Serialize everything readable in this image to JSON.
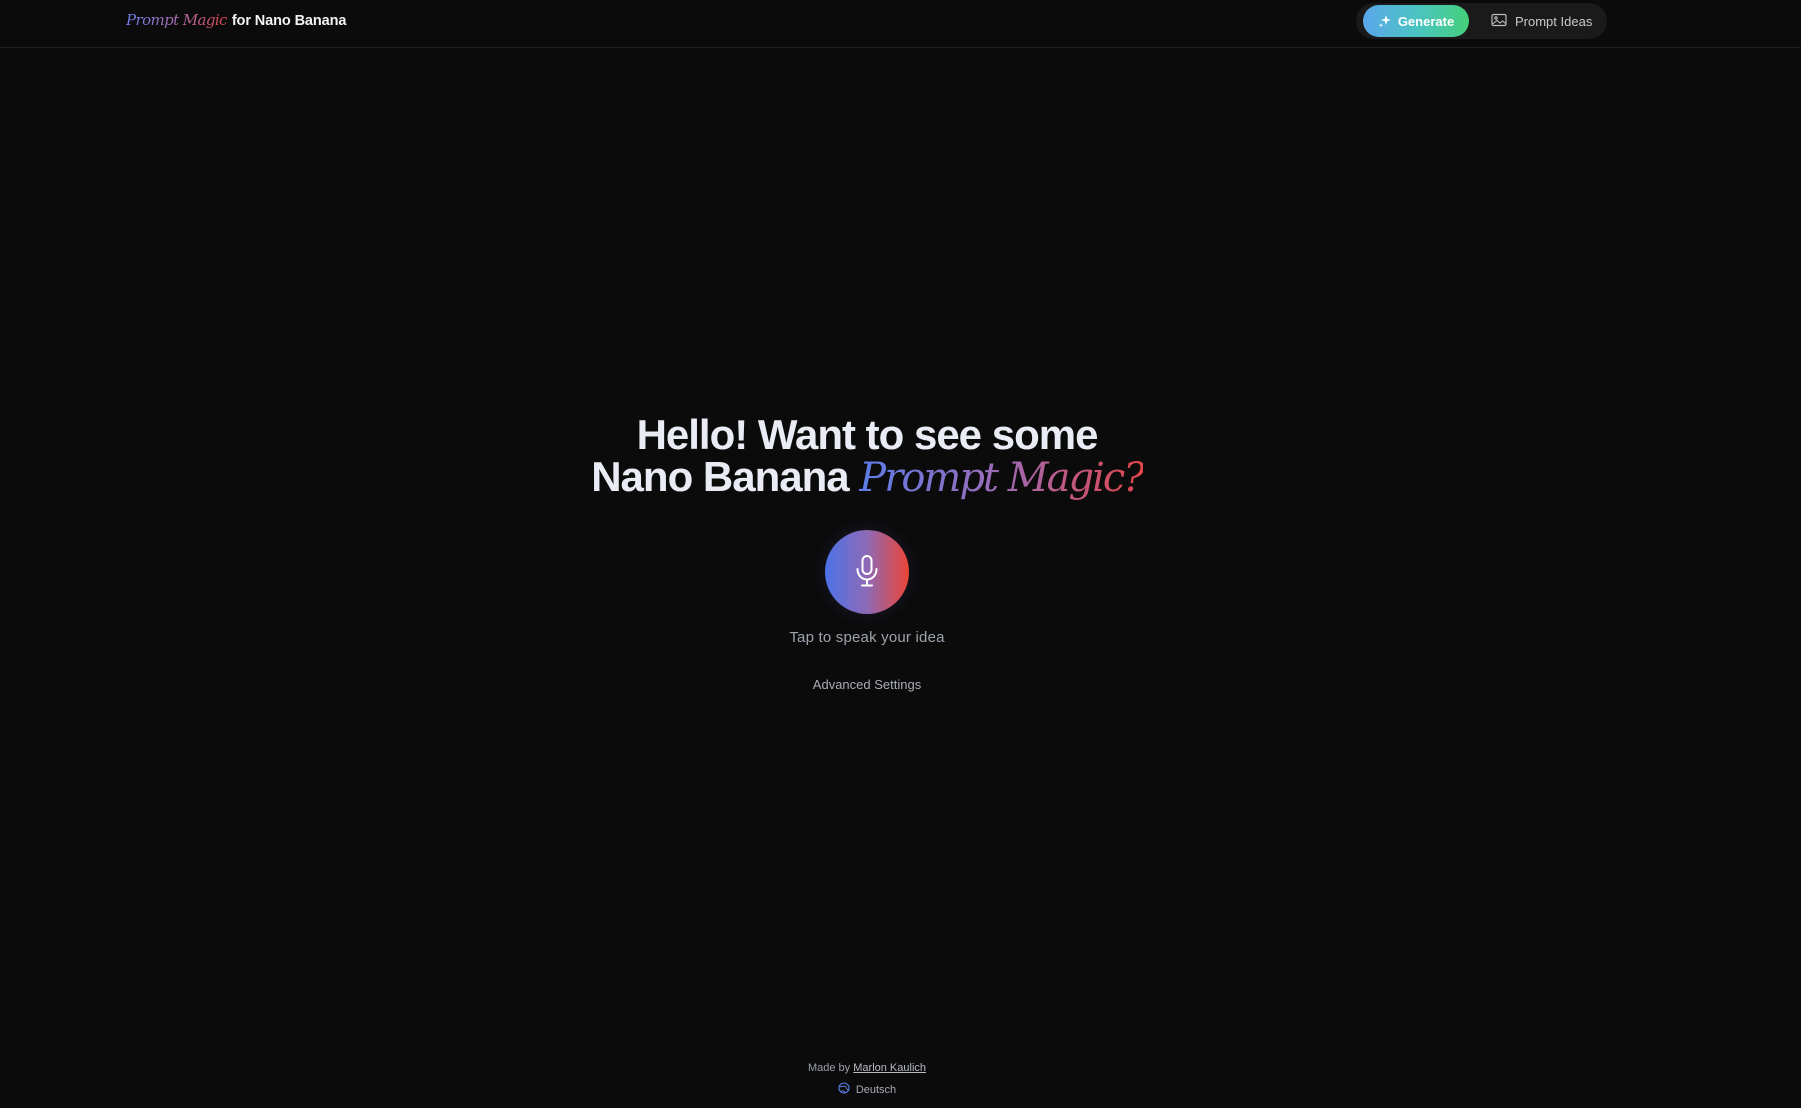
{
  "header": {
    "brand_magic": "Prompt Magic",
    "brand_rest": "for Nano Banana",
    "nav": {
      "generate_label": "Generate",
      "generate_icon": "sparkles-icon",
      "ideas_label": "Prompt Ideas",
      "ideas_icon": "image-icon"
    }
  },
  "hero": {
    "headline_line1": "Hello! Want to see some",
    "headline_line2_plain": "Nano Banana",
    "headline_line2_magic": "Prompt Magic?",
    "mic_icon": "microphone-icon",
    "tap_hint": "Tap to speak your idea",
    "advanced_settings": "Advanced Settings"
  },
  "footer": {
    "made_by_prefix": "Made by",
    "author": "Marlon Kaulich",
    "language": "Deutsch",
    "language_icon": "globe-icon"
  },
  "colors": {
    "background": "#0b0b0b",
    "brand_gradient_start": "#5c7de8",
    "brand_gradient_end": "#e2454b",
    "generate_gradient_start": "#5aa6ea",
    "generate_gradient_end": "#44d07a"
  }
}
